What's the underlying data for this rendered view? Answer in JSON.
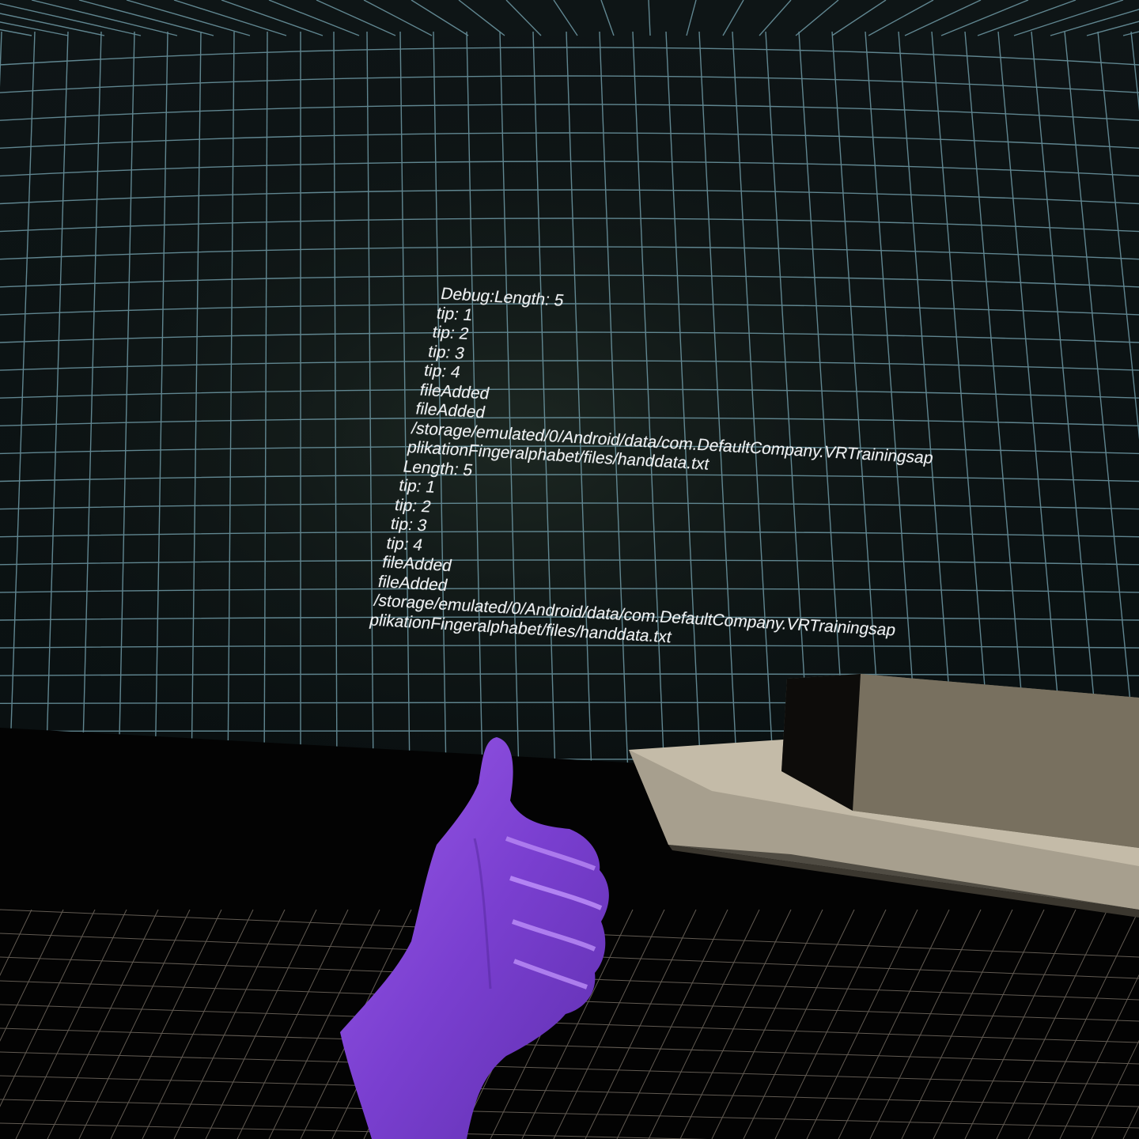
{
  "debug_console": {
    "lines": [
      "Debug:Length: 5",
      "tip: 1",
      "tip: 2",
      "tip: 3",
      "tip: 4",
      "fileAdded",
      "fileAdded",
      "/storage/emulated/0/Android/data/com.DefaultCompany.VRTrainingsap",
      "plikationFingeralphabet/files/handdata.txt",
      "Length: 5",
      "tip: 1",
      "tip: 2",
      "tip: 3",
      "tip: 4",
      "fileAdded",
      "fileAdded",
      "/storage/emulated/0/Android/data/com.DefaultCompany.VRTrainingsap",
      "plikationFingeralphabet/files/handdata.txt"
    ]
  },
  "hand": {
    "gesture": "thumbs-up",
    "color": "#7d3fd0"
  },
  "colors": {
    "grid_line": "#6f9aa6",
    "floor_grid": "#8a8074",
    "table_top": "#cfc6b3",
    "table_side": "#6e685c",
    "table_dark": "#14120f"
  }
}
